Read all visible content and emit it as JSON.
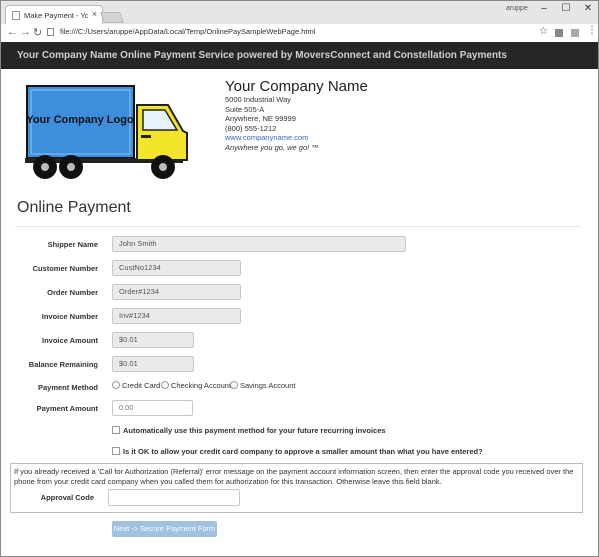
{
  "browser": {
    "tab_title": "Make Payment - Your Co",
    "tab_close": "×",
    "user_label": "aruppe",
    "minimize": "–",
    "maximize": "☐",
    "close": "✕",
    "url": "file:///C:/Users/aruppe/AppData/Local/Temp/OnlinePaySampleWebPage.html"
  },
  "banner": "Your Company Name Online Payment Service powered by MoversConnect and Constellation Payments",
  "logo": {
    "text": "Your Company Logo",
    "truck_color": "#3d8fdd",
    "cab_color": "#f2e52a"
  },
  "company": {
    "name": "Your Company Name",
    "address1": "5000 Industrial Way",
    "address2": "Suite 505-A",
    "city_state": "Anywhere, NE 99999",
    "phone": "(800) 555-1212",
    "website": "www.companyname.com",
    "tagline": "Anywhere you go, we go! ™"
  },
  "form": {
    "heading": "Online Payment",
    "shipper_label": "Shipper Name",
    "shipper_value": "John Smith",
    "customer_label": "Customer Number",
    "customer_value": "CustNo1234",
    "order_label": "Order Number",
    "order_value": "Order#1234",
    "invoice_label": "Invoice Number",
    "invoice_value": "Inv#1234",
    "invoice_amount_label": "Invoice Amount",
    "invoice_amount_value": "$0.01",
    "balance_label": "Balance Remaining",
    "balance_value": "$0.01",
    "payment_method_label": "Payment Method",
    "payment_methods": [
      "Credit Card",
      "Checking Account",
      "Savings Account"
    ],
    "payment_amount_label": "Payment Amount",
    "payment_amount_placeholder": "0.00",
    "recurring_label": "Automatically use this payment method for your future recurring invoices",
    "smaller_amount_label": "Is it OK to allow your credit card company to approve a smaller amount than what you have entered?",
    "auth_text": "If you already received a 'Call for Authorization (Referral)' error message on the payment account information screen, then enter the approval code you received over the phone from your credit card company when you called them for authorization for this transaction. Otherwise leave this field blank.",
    "approval_label": "Approval Code",
    "approval_value": "",
    "next_button": "Next -> Secure Payment Form"
  }
}
